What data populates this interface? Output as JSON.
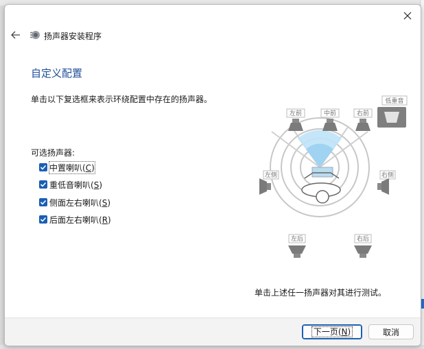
{
  "window": {
    "title": "扬声器安装程序"
  },
  "page": {
    "title": "自定义配置",
    "instructions": "单击以下复选框来表示环绕配置中存在的扬声器。",
    "optional_label": "可选扬声器:",
    "test_hint": "单击上述任一扬声器对其进行测试。"
  },
  "options": [
    {
      "label": "中置喇叭",
      "accel": "C",
      "checked": true
    },
    {
      "label": "重低音喇叭",
      "accel": "S",
      "checked": true
    },
    {
      "label": "侧面左右喇叭",
      "accel": "S",
      "checked": true
    },
    {
      "label": "后面左右喇叭",
      "accel": "R",
      "checked": true
    }
  ],
  "speakers": {
    "front_left": "左前",
    "front_center": "中前",
    "front_right": "右前",
    "subwoofer": "低重音",
    "side_left": "左侧",
    "side_right": "右侧",
    "rear_left": "左后",
    "rear_right": "右后"
  },
  "buttons": {
    "next": "下一页",
    "next_accel": "N",
    "cancel": "取消"
  },
  "colors": {
    "accent": "#1a5fb4",
    "title": "#1f4e99"
  }
}
